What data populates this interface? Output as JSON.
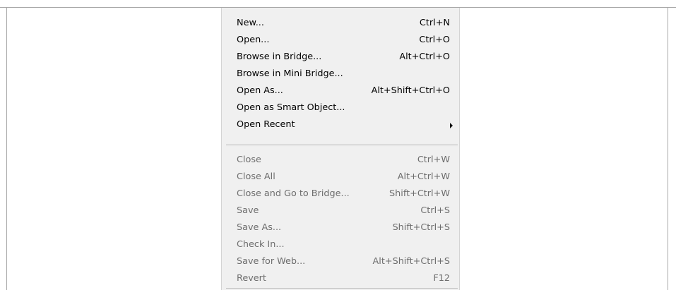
{
  "menu": {
    "items": [
      {
        "label": "New...",
        "shortcut": "Ctrl+N",
        "enabled": true,
        "submenu": false
      },
      {
        "label": "Open...",
        "shortcut": "Ctrl+O",
        "enabled": true,
        "submenu": false
      },
      {
        "label": "Browse in Bridge...",
        "shortcut": "Alt+Ctrl+O",
        "enabled": true,
        "submenu": false
      },
      {
        "label": "Browse in Mini Bridge...",
        "shortcut": "",
        "enabled": true,
        "submenu": false
      },
      {
        "label": "Open As...",
        "shortcut": "Alt+Shift+Ctrl+O",
        "enabled": true,
        "submenu": false
      },
      {
        "label": "Open as Smart Object...",
        "shortcut": "",
        "enabled": true,
        "submenu": false
      },
      {
        "label": "Open Recent",
        "shortcut": "",
        "enabled": true,
        "submenu": true
      },
      {
        "label": "Close",
        "shortcut": "Ctrl+W",
        "enabled": false,
        "submenu": false
      },
      {
        "label": "Close All",
        "shortcut": "Alt+Ctrl+W",
        "enabled": false,
        "submenu": false
      },
      {
        "label": "Close and Go to Bridge...",
        "shortcut": "Shift+Ctrl+W",
        "enabled": false,
        "submenu": false
      },
      {
        "label": "Save",
        "shortcut": "Ctrl+S",
        "enabled": false,
        "submenu": false
      },
      {
        "label": "Save As...",
        "shortcut": "Shift+Ctrl+S",
        "enabled": false,
        "submenu": false
      },
      {
        "label": "Check In...",
        "shortcut": "",
        "enabled": false,
        "submenu": false
      },
      {
        "label": "Save for Web...",
        "shortcut": "Alt+Shift+Ctrl+S",
        "enabled": false,
        "submenu": false
      },
      {
        "label": "Revert",
        "shortcut": "F12",
        "enabled": false,
        "submenu": false
      }
    ]
  },
  "icons": {
    "submenu_arrow": "submenu-arrow-icon"
  },
  "colors": {
    "menu_background": "#f0f0f0",
    "enabled_text": "#000000",
    "disabled_text": "#6d6d6d"
  }
}
